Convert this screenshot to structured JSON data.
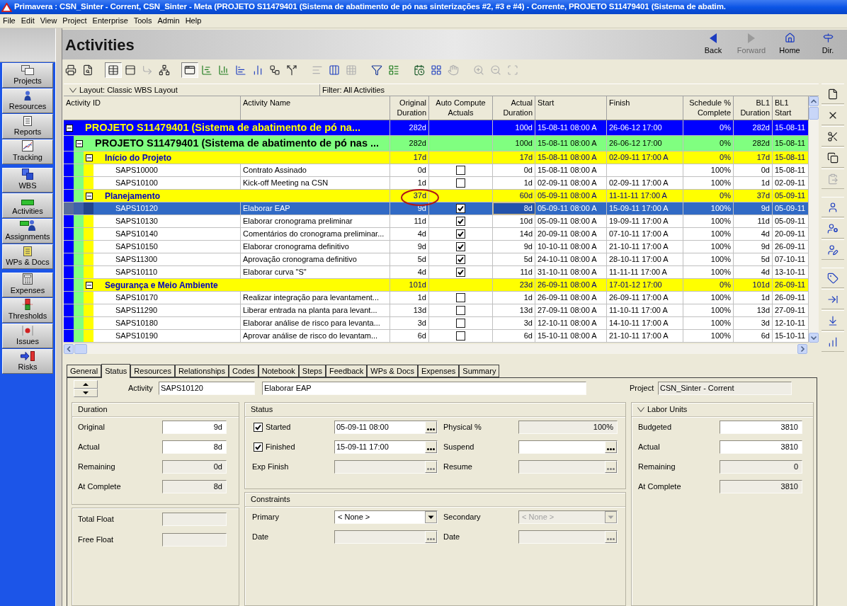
{
  "window": {
    "title": "Primavera : CSN_Sinter - Corrent, CSN_Sinter - Meta (PROJETO S11479401 (Sistema de abatimento de pó nas sinterizações #2, #3 e #4) - Corrente, PROJETO S11479401 (Sistema de abatim."
  },
  "menu": [
    "File",
    "Edit",
    "View",
    "Project",
    "Enterprise",
    "Tools",
    "Admin",
    "Help"
  ],
  "sidebar": {
    "groups": [
      [
        "Projects",
        "Resources",
        "Reports",
        "Tracking"
      ],
      [
        "WBS",
        "Activities",
        "Assignments",
        "WPs & Docs"
      ],
      [
        "Expenses",
        "Thresholds",
        "Issues",
        "Risks"
      ]
    ]
  },
  "header": {
    "title": "Activities",
    "nav": [
      {
        "label": "Back",
        "disabled": false
      },
      {
        "label": "Forward",
        "disabled": true
      },
      {
        "label": "Home",
        "disabled": false
      },
      {
        "label": "Dir.",
        "disabled": false
      }
    ]
  },
  "toolbar": {
    "groups": [
      [
        {
          "pressed": false,
          "disabled": false
        },
        {
          "pressed": false,
          "disabled": false
        }
      ],
      [
        {
          "pressed": true,
          "disabled": false
        },
        {
          "pressed": false,
          "disabled": false
        },
        {
          "pressed": false,
          "disabled": true
        },
        {
          "pressed": false,
          "disabled": false
        }
      ],
      [
        {
          "pressed": true,
          "disabled": false
        },
        {
          "pressed": false,
          "disabled": false
        },
        {
          "pressed": false,
          "disabled": false
        },
        {
          "pressed": false,
          "disabled": false
        },
        {
          "pressed": false,
          "disabled": false
        },
        {
          "pressed": false,
          "disabled": false
        },
        {
          "pressed": false,
          "disabled": false
        }
      ],
      [
        {
          "pressed": false,
          "disabled": true
        },
        {
          "pressed": false,
          "disabled": false
        },
        {
          "pressed": false,
          "disabled": true
        }
      ],
      [
        {
          "pressed": false,
          "disabled": false
        },
        {
          "pressed": false,
          "disabled": false
        }
      ],
      [
        {
          "pressed": false,
          "disabled": false
        },
        {
          "pressed": false,
          "disabled": false
        },
        {
          "pressed": false,
          "disabled": true
        }
      ],
      [
        {
          "pressed": false,
          "disabled": true
        },
        {
          "pressed": false,
          "disabled": true
        },
        {
          "pressed": false,
          "disabled": true
        }
      ]
    ]
  },
  "activities_table": {
    "layout": "Layout: Classic WBS Layout",
    "filter": "Filter: All Activities",
    "columns": [
      {
        "label": "Activity ID",
        "kind": "id"
      },
      {
        "label": "Activity Name",
        "kind": "name"
      },
      {
        "label": "Original Duration",
        "kind": "duration"
      },
      {
        "label": "Auto Compute Actuals",
        "kind": "check"
      },
      {
        "label": "Actual Duration",
        "kind": "duration"
      },
      {
        "label": "Start",
        "kind": "date"
      },
      {
        "label": "Finish",
        "kind": "date"
      },
      {
        "label": "Schedule % Complete",
        "kind": "percent"
      },
      {
        "label": "BL1 Duration",
        "kind": "duration"
      },
      {
        "label": "BL1 Start",
        "kind": "date"
      }
    ],
    "rows": [
      {
        "kind": "wbs",
        "name": "PROJETO S11479401 (Sistema de abatimento de pó na...",
        "expanded": true,
        "selected": false,
        "original_duration": "282d",
        "actual_duration": "100d",
        "start": "15-08-11 08:00 A",
        "finish": "26-06-12 17:00",
        "schedule_complete": "0%",
        "bl1_duration": "282d",
        "bl1_start": "15-08-11",
        "children": [
          {
            "kind": "wbs",
            "name": "PROJETO S11479401 (Sistema de abatimento de pó nas ...",
            "expanded": true,
            "selected": false,
            "original_duration": "282d",
            "actual_duration": "100d",
            "start": "15-08-11 08:00 A",
            "finish": "26-06-12 17:00",
            "schedule_complete": "0%",
            "bl1_duration": "282d",
            "bl1_start": "15-08-11",
            "children": [
              {
                "kind": "wbs",
                "name": "Início do Projeto",
                "expanded": true,
                "selected": false,
                "original_duration": "17d",
                "actual_duration": "17d",
                "start": "15-08-11 08:00 A",
                "finish": "02-09-11 17:00 A",
                "schedule_complete": "0%",
                "bl1_duration": "17d",
                "bl1_start": "15-08-11",
                "children": [
                  {
                    "kind": "activity",
                    "id": "SAPS10000",
                    "name": "Contrato Assinado",
                    "original_duration": "0d",
                    "auto_compute_actuals": false,
                    "actual_duration": "0d",
                    "start": "15-08-11 08:00 A",
                    "schedule_complete": "100%",
                    "bl1_duration": "0d",
                    "bl1_start": "15-08-11",
                    "selected": false
                  },
                  {
                    "kind": "activity",
                    "id": "SAPS10100",
                    "name": "Kick-off Meeting na CSN",
                    "original_duration": "1d",
                    "auto_compute_actuals": false,
                    "actual_duration": "1d",
                    "start": "02-09-11 08:00 A",
                    "finish": "02-09-11 17:00 A",
                    "schedule_complete": "100%",
                    "bl1_duration": "1d",
                    "bl1_start": "02-09-11",
                    "selected": false
                  }
                ]
              },
              {
                "kind": "wbs",
                "name": "Planejamento",
                "expanded": true,
                "selected": false,
                "original_duration_circled": true,
                "original_duration": "37d",
                "actual_duration": "60d",
                "start": "05-09-11 08:00 A",
                "finish": "11-11-11 17:00 A",
                "schedule_complete": "0%",
                "bl1_duration": "37d",
                "bl1_start": "05-09-11",
                "children": [
                  {
                    "kind": "activity",
                    "id": "SAPS10120",
                    "name": "Elaborar EAP",
                    "original_duration": "9d",
                    "auto_compute_actuals": true,
                    "actual_duration": "8d",
                    "actual_duration_focused": true,
                    "start": "05-09-11 08:00 A",
                    "finish": "15-09-11 17:00 A",
                    "schedule_complete": "100%",
                    "bl1_duration": "9d",
                    "bl1_start": "05-09-11",
                    "selected": true
                  },
                  {
                    "kind": "activity",
                    "id": "SAPS10130",
                    "name": "Elaborar cronograma preliminar",
                    "original_duration": "11d",
                    "auto_compute_actuals": true,
                    "actual_duration": "10d",
                    "start": "05-09-11 08:00 A",
                    "finish": "19-09-11 17:00 A",
                    "schedule_complete": "100%",
                    "bl1_duration": "11d",
                    "bl1_start": "05-09-11",
                    "selected": false
                  },
                  {
                    "kind": "activity",
                    "id": "SAPS10140",
                    "name": "Comentários do cronograma preliminar...",
                    "original_duration": "4d",
                    "auto_compute_actuals": true,
                    "actual_duration": "14d",
                    "start": "20-09-11 08:00 A",
                    "finish": "07-10-11 17:00 A",
                    "schedule_complete": "100%",
                    "bl1_duration": "4d",
                    "bl1_start": "20-09-11",
                    "selected": false
                  },
                  {
                    "kind": "activity",
                    "id": "SAPS10150",
                    "name": "Elaborar cronograma definitivo",
                    "original_duration": "9d",
                    "auto_compute_actuals": true,
                    "actual_duration": "9d",
                    "start": "10-10-11 08:00 A",
                    "finish": "21-10-11 17:00 A",
                    "schedule_complete": "100%",
                    "bl1_duration": "9d",
                    "bl1_start": "26-09-11",
                    "selected": false
                  },
                  {
                    "kind": "activity",
                    "id": "SAPS11300",
                    "name": "Aprovação cronograma definitivo",
                    "original_duration": "5d",
                    "auto_compute_actuals": true,
                    "actual_duration": "5d",
                    "start": "24-10-11 08:00 A",
                    "finish": "28-10-11 17:00 A",
                    "schedule_complete": "100%",
                    "bl1_duration": "5d",
                    "bl1_start": "07-10-11",
                    "selected": false
                  },
                  {
                    "kind": "activity",
                    "id": "SAPS10110",
                    "name": "Elaborar curva \"S\"",
                    "original_duration": "4d",
                    "auto_compute_actuals": true,
                    "actual_duration": "11d",
                    "start": "31-10-11 08:00 A",
                    "finish": "11-11-11 17:00 A",
                    "schedule_complete": "100%",
                    "bl1_duration": "4d",
                    "bl1_start": "13-10-11",
                    "selected": false
                  }
                ]
              },
              {
                "kind": "wbs",
                "name": "Segurança e Meio Ambiente",
                "expanded": true,
                "selected": false,
                "original_duration": "101d",
                "actual_duration": "23d",
                "start": "26-09-11 08:00 A",
                "finish": "17-01-12 17:00",
                "schedule_complete": "0%",
                "bl1_duration": "101d",
                "bl1_start": "26-09-11",
                "children": [
                  {
                    "kind": "activity",
                    "id": "SAPS10170",
                    "name": "Realizar integração para levantament...",
                    "original_duration": "1d",
                    "auto_compute_actuals": false,
                    "actual_duration": "1d",
                    "start": "26-09-11 08:00 A",
                    "finish": "26-09-11 17:00 A",
                    "schedule_complete": "100%",
                    "bl1_duration": "1d",
                    "bl1_start": "26-09-11",
                    "selected": false
                  },
                  {
                    "kind": "activity",
                    "id": "SAPS11290",
                    "name": "Liberar entrada na planta para levant...",
                    "original_duration": "13d",
                    "auto_compute_actuals": false,
                    "actual_duration": "13d",
                    "start": "27-09-11 08:00 A",
                    "finish": "11-10-11 17:00 A",
                    "schedule_complete": "100%",
                    "bl1_duration": "13d",
                    "bl1_start": "27-09-11",
                    "selected": false
                  },
                  {
                    "kind": "activity",
                    "id": "SAPS10180",
                    "name": "Elaborar análise de risco para levanta...",
                    "original_duration": "3d",
                    "auto_compute_actuals": false,
                    "actual_duration": "3d",
                    "start": "12-10-11 08:00 A",
                    "finish": "14-10-11 17:00 A",
                    "schedule_complete": "100%",
                    "bl1_duration": "3d",
                    "bl1_start": "12-10-11",
                    "selected": false
                  },
                  {
                    "kind": "activity",
                    "id": "SAPS10190",
                    "name": "Aprovar análise de risco do levantam...",
                    "original_duration": "6d",
                    "auto_compute_actuals": false,
                    "actual_duration": "6d",
                    "start": "15-10-11 08:00 A",
                    "finish": "21-10-11 17:00 A",
                    "schedule_complete": "100%",
                    "bl1_duration": "6d",
                    "bl1_start": "15-10-11",
                    "selected": false
                  }
                ]
              }
            ]
          }
        ]
      }
    ]
  },
  "side_toolbar": {
    "groups": [
      [
        {
          "disabled": false
        },
        {
          "disabled": false
        },
        {
          "disabled": false
        },
        {
          "disabled": false
        },
        {
          "disabled": true
        }
      ],
      [
        {
          "disabled": false
        },
        {
          "disabled": false
        },
        {
          "disabled": false
        }
      ],
      [
        {
          "disabled": false
        },
        {
          "disabled": false
        },
        {
          "disabled": false
        },
        {
          "disabled": false
        }
      ]
    ]
  },
  "details": {
    "tabs": [
      {
        "label": "General",
        "selected": false
      },
      {
        "label": "Status",
        "selected": true
      },
      {
        "label": "Resources",
        "selected": false
      },
      {
        "label": "Relationships",
        "selected": false
      },
      {
        "label": "Codes",
        "selected": false
      },
      {
        "label": "Notebook",
        "selected": false
      },
      {
        "label": "Steps",
        "selected": false
      },
      {
        "label": "Feedback",
        "selected": false
      },
      {
        "label": "WPs & Docs",
        "selected": false
      },
      {
        "label": "Expenses",
        "selected": false
      },
      {
        "label": "Summary",
        "selected": false
      }
    ],
    "activity": {
      "label": "Activity",
      "id": "SAPS10120",
      "name": "Elaborar EAP"
    },
    "project": {
      "label": "Project",
      "value": "CSN_Sinter - Corrent",
      "disabled": true
    },
    "duration": {
      "title": "Duration",
      "fields": [
        {
          "label": "Original",
          "value": "9d",
          "disabled": false
        },
        {
          "label": "Actual",
          "value": "8d",
          "disabled": false
        },
        {
          "label": "Remaining",
          "value": "0d",
          "disabled": true
        },
        {
          "label": "At Complete",
          "value": "8d",
          "disabled": true
        }
      ]
    },
    "float": {
      "fields": [
        {
          "label": "Total Float",
          "disabled": true
        },
        {
          "label": "Free Float",
          "disabled": true
        }
      ]
    },
    "status": {
      "title": "Status",
      "fields": [
        {
          "kind": "check-date",
          "label": "Started",
          "checked": true,
          "value": "05-09-11 08:00",
          "disabled": false
        },
        {
          "kind": "number",
          "label": "Physical %",
          "value": "100%",
          "disabled": true
        },
        {
          "kind": "check-date",
          "label": "Finished",
          "checked": true,
          "value": "15-09-11 17:00",
          "disabled": false
        },
        {
          "kind": "date",
          "label": "Suspend",
          "disabled": false
        },
        {
          "kind": "date",
          "label": "Exp Finish",
          "disabled": true
        },
        {
          "kind": "date",
          "label": "Resume",
          "disabled": true
        }
      ]
    },
    "constraints": {
      "title": "Constraints",
      "fields": [
        {
          "kind": "select",
          "label": "Primary",
          "value": "< None >",
          "disabled": false
        },
        {
          "kind": "select",
          "label": "Secondary",
          "value": "< None >",
          "disabled": true
        },
        {
          "kind": "date",
          "label": "Date",
          "disabled": true
        },
        {
          "kind": "date",
          "label": "Date",
          "disabled": true
        }
      ]
    },
    "labor_units": {
      "title": "Labor Units",
      "expanded": true,
      "fields": [
        {
          "label": "Budgeted",
          "value": "3810",
          "disabled": false
        },
        {
          "label": "Actual",
          "value": "3810",
          "disabled": false
        },
        {
          "label": "Remaining",
          "value": "0",
          "disabled": true
        },
        {
          "label": "At Complete",
          "value": "3810",
          "disabled": true
        }
      ]
    }
  }
}
